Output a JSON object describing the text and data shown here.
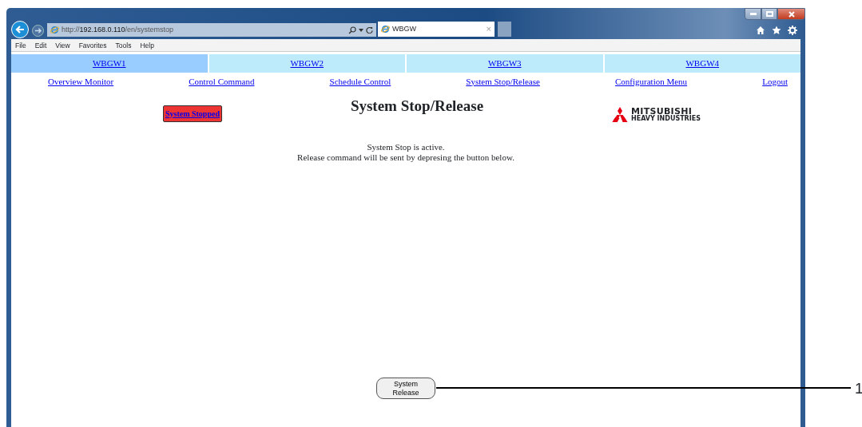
{
  "browser": {
    "address": {
      "scheme": "http://",
      "host": "192.168.0.110",
      "path": "/en/systemstop"
    },
    "tab": {
      "title": "WBGW",
      "close": "×"
    },
    "menu": [
      "File",
      "Edit",
      "View",
      "Favorites",
      "Tools",
      "Help"
    ]
  },
  "unit_tabs": [
    {
      "label": "WBGW1",
      "selected": true
    },
    {
      "label": "WBGW2",
      "selected": false
    },
    {
      "label": "WBGW3",
      "selected": false
    },
    {
      "label": "WBGW4",
      "selected": false
    }
  ],
  "nav_links": [
    "Overview Monitor",
    "Control Command",
    "Schedule Control",
    "System Stop/Release",
    "Configuration Menu",
    "Logout"
  ],
  "status_badge": "System Stopped",
  "title": "System Stop/Release",
  "logo": {
    "name": "MITSUBISHI",
    "subtitle": "HEAVY INDUSTRIES"
  },
  "message": [
    "System Stop is active.",
    "Release command will be sent by depresing the button below."
  ],
  "release_button": "System Release",
  "callout": "1"
}
